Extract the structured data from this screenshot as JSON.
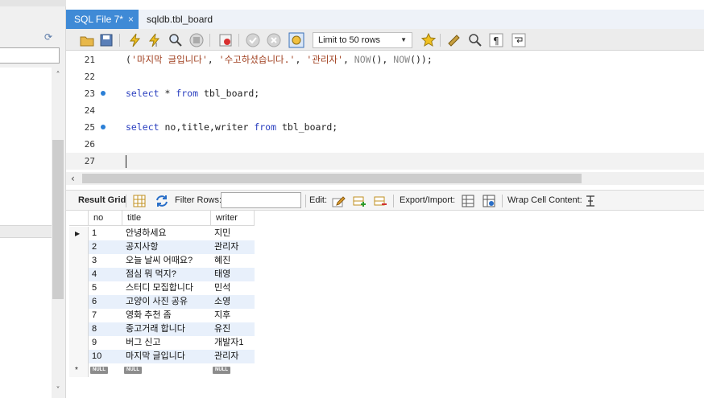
{
  "tabs": [
    {
      "label": "SQL File 7*",
      "active": true
    },
    {
      "label": "sqldb.tbl_board",
      "active": false
    }
  ],
  "toolbar": {
    "limit_label": "Limit to 50 rows"
  },
  "editor": {
    "lines": [
      {
        "num": "21",
        "dot": false,
        "code": "('마지막 글입니다', '수고하셨습니다.', '관리자', NOW(), NOW());"
      },
      {
        "num": "22",
        "dot": false,
        "code": ""
      },
      {
        "num": "23",
        "dot": true,
        "code": "select * from tbl_board;"
      },
      {
        "num": "24",
        "dot": false,
        "code": ""
      },
      {
        "num": "25",
        "dot": true,
        "code": "select no,title,writer from tbl_board;"
      },
      {
        "num": "26",
        "dot": false,
        "code": ""
      },
      {
        "num": "27",
        "dot": false,
        "code": ""
      }
    ]
  },
  "result_toolbar": {
    "result_grid": "Result Grid",
    "filter_rows": "Filter Rows:",
    "edit": "Edit:",
    "export_import": "Export/Import:",
    "wrap_cell": "Wrap Cell Content:"
  },
  "grid": {
    "columns": [
      "no",
      "title",
      "writer"
    ],
    "rows": [
      [
        "1",
        "안녕하세요",
        "지민"
      ],
      [
        "2",
        "공지사항",
        "관리자"
      ],
      [
        "3",
        "오늘 날씨 어때요?",
        "혜진"
      ],
      [
        "4",
        "점심 뭐 먹지?",
        "태영"
      ],
      [
        "5",
        "스터디 모집합니다",
        "민석"
      ],
      [
        "6",
        "고양이 사진 공유",
        "소영"
      ],
      [
        "7",
        "영화 추천 좀",
        "지후"
      ],
      [
        "8",
        "중고거래 합니다",
        "유진"
      ],
      [
        "9",
        "버그 신고",
        "개발자1"
      ],
      [
        "10",
        "마지막 글입니다",
        "관리자"
      ]
    ],
    "null_label": "NULL"
  },
  "colors": {
    "tab_active": "#3f8ad6",
    "keyword": "#2a3fbf",
    "string": "#a04020",
    "row_alt": "#e8f0fb"
  }
}
